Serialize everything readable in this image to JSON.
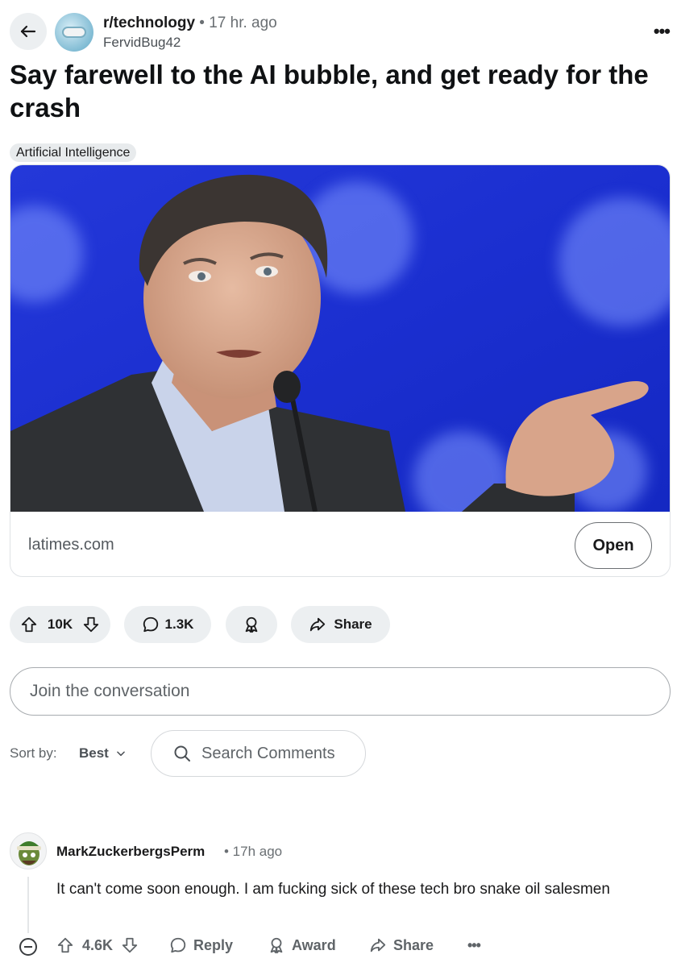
{
  "header": {
    "subreddit": "r/technology",
    "time": "• 17 hr. ago",
    "author": "FervidBug42"
  },
  "post": {
    "title": "Say farewell to the AI bubble, and get ready for the crash",
    "flair": "Artificial Intelligence",
    "link": {
      "domain": "latimes.com",
      "open_label": "Open"
    },
    "actions": {
      "votes": "10K",
      "comments": "1.3K",
      "share_label": "Share"
    }
  },
  "composer": {
    "placeholder": "Join the conversation"
  },
  "sort": {
    "label": "Sort by:",
    "value": "Best",
    "search_placeholder": "Search Comments"
  },
  "comment": {
    "author": "MarkZuckerbergsPerm",
    "time": "• 17h ago",
    "body": "It can't come soon enough. I am fucking sick of these tech bro snake oil salesmen",
    "votes": "4.6K",
    "reply_label": "Reply",
    "award_label": "Award",
    "share_label": "Share",
    "more_label": "•••"
  },
  "icons": {
    "back": "arrow-left-icon",
    "more": "more-horizontal-icon",
    "upvote": "arrow-up-icon",
    "downvote": "arrow-down-icon",
    "comment": "speech-bubble-icon",
    "award": "award-ribbon-icon",
    "share": "share-arrow-icon",
    "search": "search-icon",
    "collapse": "minus-circle-icon",
    "chevron": "chevron-down-icon"
  },
  "colors": {
    "pill_bg": "#eceff1",
    "text_primary": "#1a1a1b",
    "text_secondary": "#5f6468",
    "image_backdrop": "#1b2fd6"
  }
}
